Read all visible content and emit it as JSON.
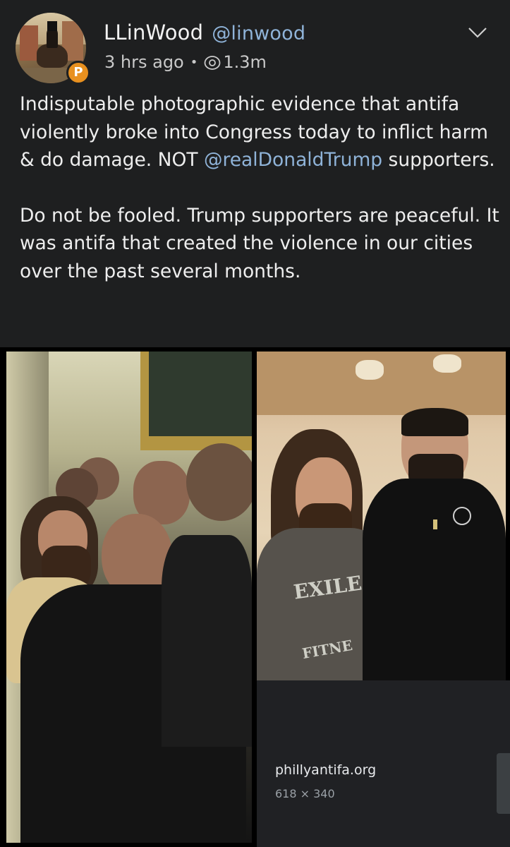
{
  "post": {
    "author_name": "LLinWood",
    "author_handle": "@linwood",
    "time_ago": "3 hrs ago",
    "separator": "•",
    "view_count": "1.3m",
    "platform_badge_letter": "P",
    "paragraph1_part1": "Indisputable photographic evidence that antifa violently broke into Congress today to inflict harm & do damage. NOT ",
    "paragraph1_mention": "@realDonaldTrump",
    "paragraph1_part2": " supporters.",
    "paragraph2": "Do not be fooled. Trump supporters are peaceful. It was antifa that created the violence in our cities over the past several months."
  },
  "image_panel": {
    "source_site": "phillyantifa.org",
    "dimensions": "618 × 340"
  },
  "photo_right_shirt_text": {
    "line1": "EXILE",
    "line2": "FITNE"
  },
  "colors": {
    "background": "#1e1f20",
    "text": "#eeeeee",
    "mention": "#8fb3d8",
    "badge": "#e8901f",
    "meta": "#c9c9c9"
  },
  "icons": {
    "menu": "chevron-down-icon",
    "views": "eye-icon",
    "badge": "parler-badge-icon"
  }
}
